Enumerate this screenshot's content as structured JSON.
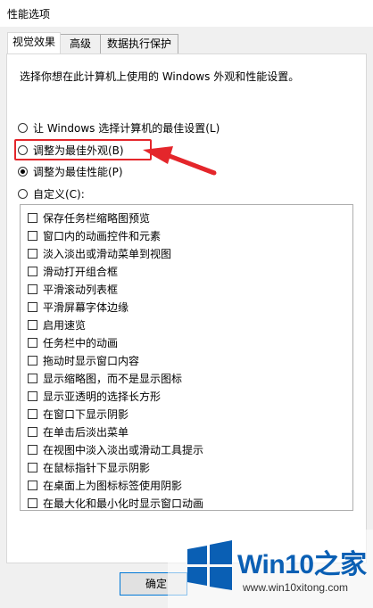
{
  "window": {
    "title": "性能选项"
  },
  "tabs": [
    {
      "label": "视觉效果",
      "active": true
    },
    {
      "label": "高级",
      "active": false
    },
    {
      "label": "数据执行保护",
      "active": false
    }
  ],
  "description": "选择你想在此计算机上使用的 Windows 外观和性能设置。",
  "radios": [
    {
      "label": "让 Windows 选择计算机的最佳设置(L)",
      "checked": false
    },
    {
      "label": "调整为最佳外观(B)",
      "checked": false
    },
    {
      "label": "调整为最佳性能(P)",
      "checked": true
    },
    {
      "label": "自定义(C):",
      "checked": false
    }
  ],
  "effects": [
    "保存任务栏缩略图预览",
    "窗口内的动画控件和元素",
    "淡入淡出或滑动菜单到视图",
    "滑动打开组合框",
    "平滑滚动列表框",
    "平滑屏幕字体边缘",
    "启用速览",
    "任务栏中的动画",
    "拖动时显示窗口内容",
    "显示缩略图，而不是显示图标",
    "显示亚透明的选择长方形",
    "在窗口下显示阴影",
    "在单击后淡出菜单",
    "在视图中淡入淡出或滑动工具提示",
    "在鼠标指针下显示阴影",
    "在桌面上为图标标签使用阴影",
    "在最大化和最小化时显示窗口动画"
  ],
  "buttons": {
    "ok": "确定"
  },
  "watermark": {
    "brand": "Win10之家",
    "url": "www.win10xitong.com"
  },
  "colors": {
    "highlight": "#e4262b",
    "accent": "#0078d7",
    "brand": "#0a5fb4"
  }
}
